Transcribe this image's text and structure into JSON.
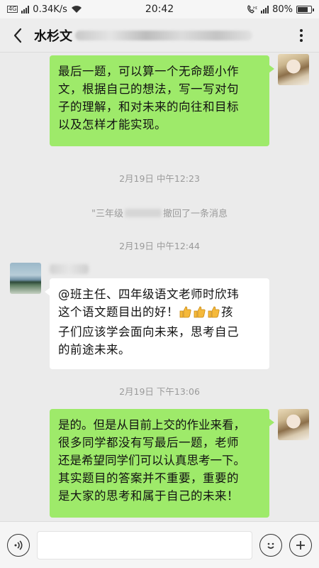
{
  "status_bar": {
    "signal_tag": "4G",
    "network_speed": "0.34K/s",
    "time": "20:42",
    "battery_percent": "80%",
    "battery_level": 0.8
  },
  "header": {
    "title": "水杉文"
  },
  "messages": [
    {
      "side": "right",
      "lines": [
        "最后一题，可以算一个无命题小作",
        "文，根据自己的想法，写一写对句",
        "子的理解，和对未来的向往和目标",
        "以及怎样才能实现。"
      ]
    },
    {
      "side": "left",
      "lines": [
        "@班主任、四年级语文老师时欣玮",
        "这个语文题目出的好！",
        "孩",
        "子们应该学会面向未来，思考自己",
        "的前途未来。"
      ]
    },
    {
      "side": "right",
      "lines": [
        "是的。但是从目前上交的作业来看，",
        "很多同学都没有写最后一题，老师",
        "还是希望同学们可以认真思考一下。",
        "其实题目的答案并不重要，重要的",
        "是大家的思考和属于自己的未来！"
      ]
    }
  ],
  "system": {
    "timestamp_1": "2月19日 中午12:23",
    "recall_prefix": "\"三年级",
    "recall_suffix": "撤回了一条消息",
    "timestamp_2": "2月19日 中午12:44",
    "timestamp_3": "2月19日 下午13:06"
  },
  "icons": {
    "back": "chevron-left-icon",
    "more": "more-vertical-icon",
    "voice": "voice-icon",
    "emoji": "emoji-icon",
    "plus": "plus-icon",
    "thumbs": "thumbs-up-icon"
  },
  "colors": {
    "right_bubble": "#9eea6a",
    "left_bubble": "#ffffff",
    "chat_background": "#ebebeb"
  }
}
